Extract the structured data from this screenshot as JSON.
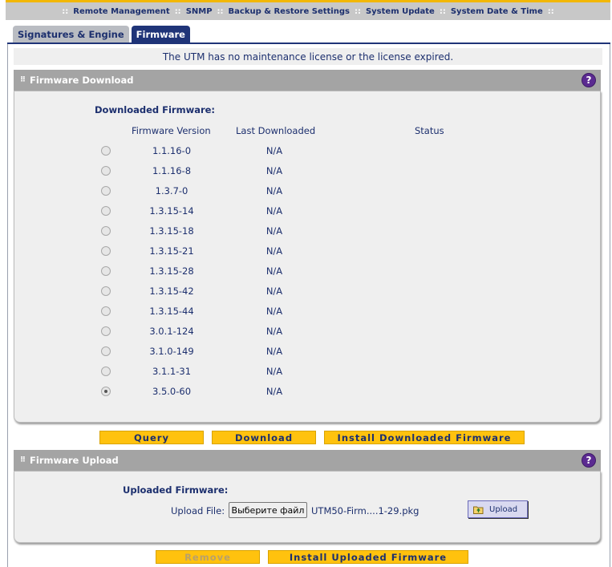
{
  "topnav": {
    "items": [
      "Remote Management",
      "SNMP",
      "Backup & Restore Settings",
      "System Update",
      "System Date & Time"
    ],
    "separator": "::"
  },
  "tabs": [
    {
      "label": "Signatures & Engine",
      "active": false
    },
    {
      "label": "Firmware",
      "active": true
    }
  ],
  "license_notice": "The UTM has no maintenance license or the license expired.",
  "download": {
    "section_title": "Firmware Download",
    "help": "?",
    "title": "Downloaded Firmware:",
    "columns": [
      "Firmware Version",
      "Last Downloaded",
      "Status"
    ],
    "rows": [
      {
        "version": "1.1.16-0",
        "last": "N/A",
        "selected": false
      },
      {
        "version": "1.1.16-8",
        "last": "N/A",
        "selected": false
      },
      {
        "version": "1.3.7-0",
        "last": "N/A",
        "selected": false
      },
      {
        "version": "1.3.15-14",
        "last": "N/A",
        "selected": false
      },
      {
        "version": "1.3.15-18",
        "last": "N/A",
        "selected": false
      },
      {
        "version": "1.3.15-21",
        "last": "N/A",
        "selected": false
      },
      {
        "version": "1.3.15-28",
        "last": "N/A",
        "selected": false
      },
      {
        "version": "1.3.15-42",
        "last": "N/A",
        "selected": false
      },
      {
        "version": "1.3.15-44",
        "last": "N/A",
        "selected": false
      },
      {
        "version": "3.0.1-124",
        "last": "N/A",
        "selected": false
      },
      {
        "version": "3.1.0-149",
        "last": "N/A",
        "selected": false
      },
      {
        "version": "3.1.1-31",
        "last": "N/A",
        "selected": false
      },
      {
        "version": "3.5.0-60",
        "last": "N/A",
        "selected": true
      }
    ],
    "buttons": {
      "query": "Query",
      "download": "Download",
      "install": "Install Downloaded Firmware"
    }
  },
  "upload": {
    "section_title": "Firmware Upload",
    "help": "?",
    "title": "Uploaded Firmware:",
    "file_label": "Upload File:",
    "choose_file": "Выберите файл",
    "file_name": "UTM50-Firm....1-29.pkg",
    "upload_button": "Upload",
    "buttons": {
      "remove": "Remove",
      "install": "Install Uploaded Firmware"
    }
  },
  "colors": {
    "accent_yellow": "#ffc20e",
    "navy": "#1c2f6e",
    "tab_active": "#1f3478",
    "help_purple": "#5b2a91"
  }
}
